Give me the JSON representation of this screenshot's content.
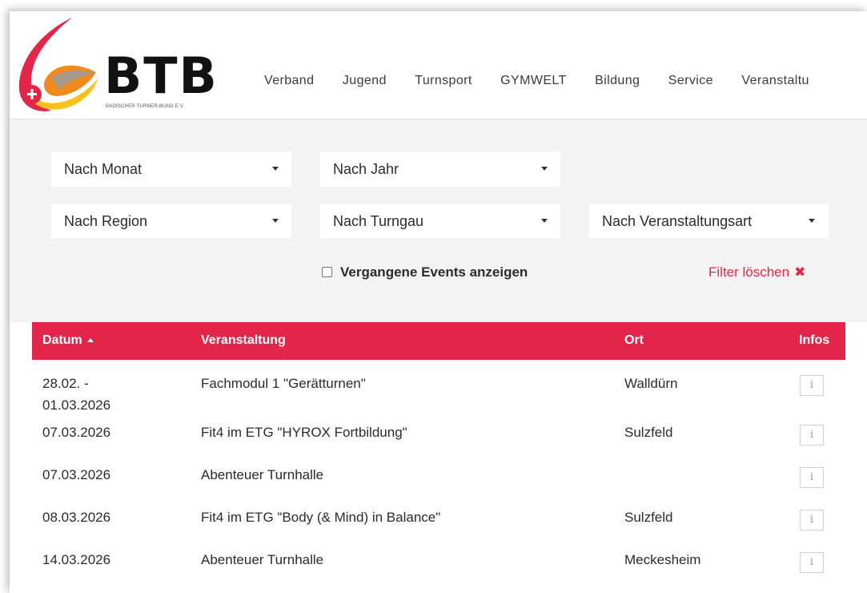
{
  "brand": {
    "name": "BTB",
    "subtitle": "BADISCHER TURNER-BUND E.V.",
    "colors": {
      "red": "#e3254a",
      "orange": "#f18a1c",
      "yellow": "#f7c21b",
      "gray": "#8a8a8a"
    }
  },
  "nav": {
    "items": [
      "Verband",
      "Jugend",
      "Turnsport",
      "GYMWELT",
      "Bildung",
      "Service",
      "Veranstaltu"
    ]
  },
  "filters": {
    "month": "Nach Monat",
    "year": "Nach Jahr",
    "region": "Nach Region",
    "turngau": "Nach Turngau",
    "event_type": "Nach Veranstaltungsart",
    "past_events_label": "Vergangene Events anzeigen",
    "past_events_checked": false,
    "clear_label": "Filter löschen",
    "clear_icon": "✖"
  },
  "table": {
    "accent": "#e3254a",
    "headers": {
      "date": "Datum",
      "event": "Veranstaltung",
      "place": "Ort",
      "info": "Infos"
    },
    "rows": [
      {
        "date_line1": "28.02. -",
        "date_line2": "01.03.2026",
        "event": "Fachmodul 1 \"Gerätturnen\"",
        "place": "Walldürn",
        "info_icon": "i"
      },
      {
        "date_line1": "07.03.2026",
        "date_line2": "",
        "event": "Fit4 im ETG \"HYROX Fortbildung\"",
        "place": "Sulzfeld",
        "info_icon": "i"
      },
      {
        "date_line1": "07.03.2026",
        "date_line2": "",
        "event": "Abenteuer Turnhalle",
        "place": "",
        "info_icon": "i"
      },
      {
        "date_line1": "08.03.2026",
        "date_line2": "",
        "event": "Fit4 im ETG \"Body (& Mind) in Balance\"",
        "place": "Sulzfeld",
        "info_icon": "i"
      },
      {
        "date_line1": "14.03.2026",
        "date_line2": "",
        "event": "Abenteuer Turnhalle",
        "place": "Meckesheim",
        "info_icon": "i"
      }
    ]
  }
}
